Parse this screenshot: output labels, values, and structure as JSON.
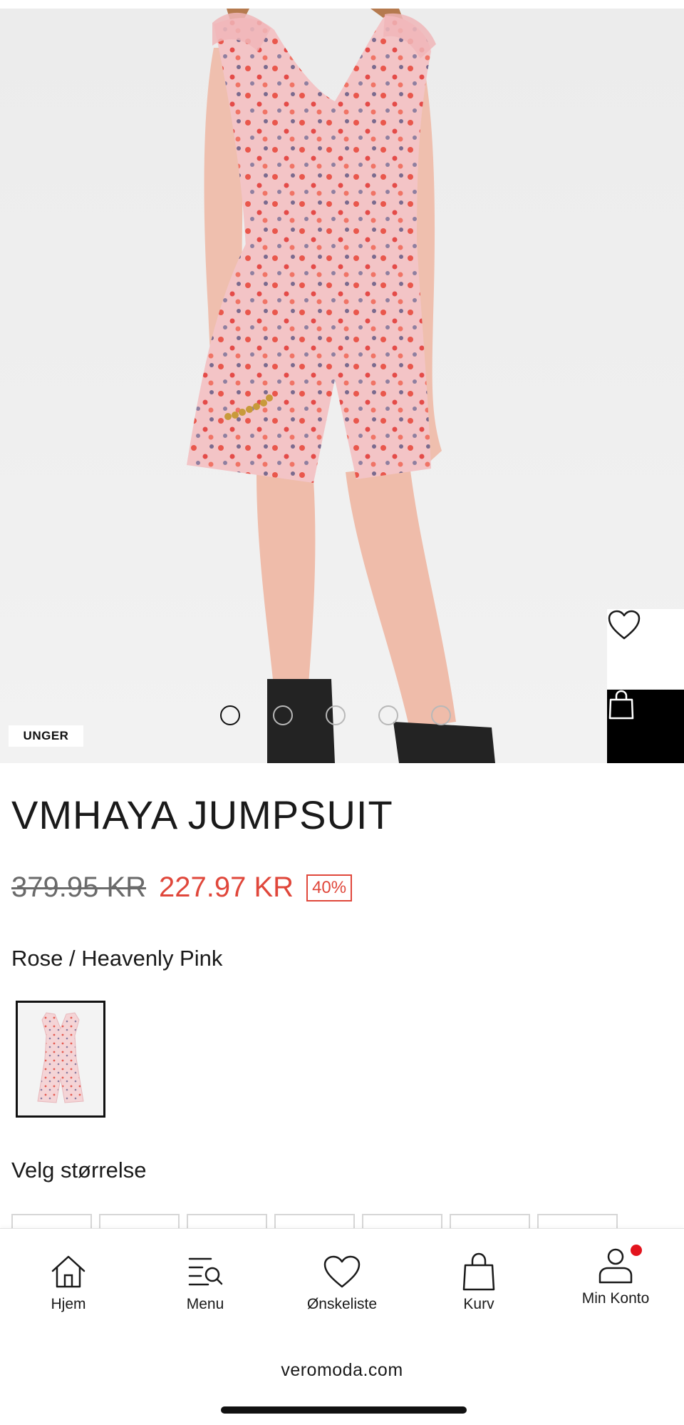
{
  "hero": {
    "category_tag": "UNGER",
    "carousel": {
      "count": 5,
      "active_index": 0
    },
    "wishlist_icon": "heart-outline-icon",
    "add_to_bag_icon": "shopping-bag-icon"
  },
  "product": {
    "name": "VMHAYA JUMPSUIT",
    "old_price": "379.95 KR",
    "new_price": "227.97 KR",
    "discount": "40%",
    "color_name": "Rose / Heavenly Pink",
    "size_heading": "Velg størrelse"
  },
  "colors": {
    "sale_red": "#e0473b",
    "notify_dot": "#e3141d"
  },
  "bottom_nav": {
    "items": [
      {
        "label": "Hjem",
        "icon": "house-icon"
      },
      {
        "label": "Menu",
        "icon": "menu-search-icon"
      },
      {
        "label": "Ønskeliste",
        "icon": "heart-icon"
      },
      {
        "label": "Kurv",
        "icon": "bag-icon"
      },
      {
        "label": "Min Konto",
        "icon": "account-icon"
      }
    ]
  },
  "browser": {
    "url": "veromoda.com"
  }
}
